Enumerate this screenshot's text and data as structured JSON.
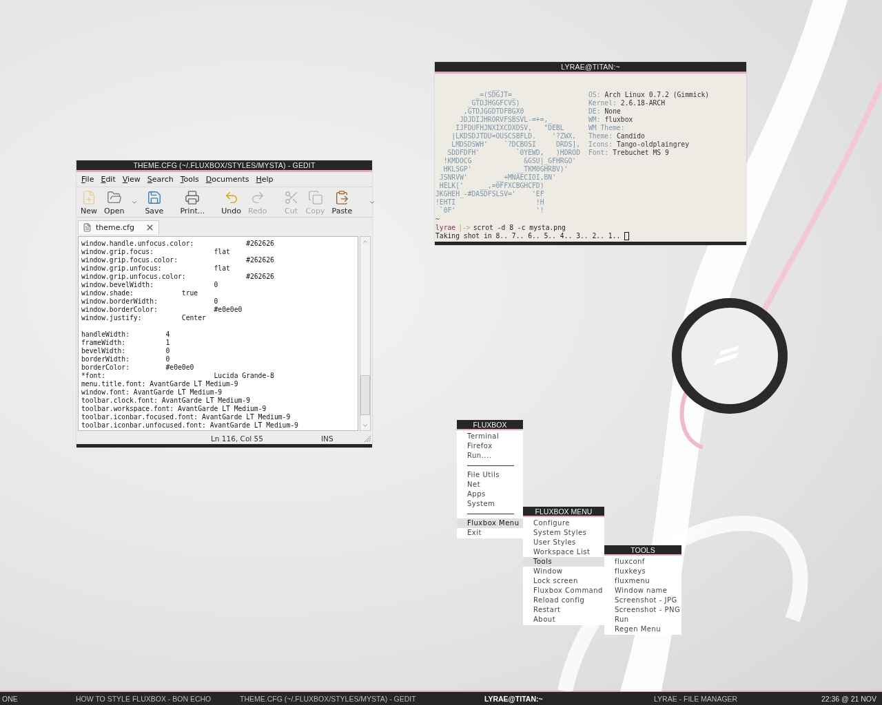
{
  "editor": {
    "title": "THEME.CFG (~/.FLUXBOX/STYLES/MYSTA) - GEDIT",
    "menu": [
      "File",
      "Edit",
      "View",
      "Search",
      "Tools",
      "Documents",
      "Help"
    ],
    "toolbar": [
      {
        "kind": "button",
        "label": "New",
        "disabled": false
      },
      {
        "kind": "button",
        "label": "Open",
        "disabled": false
      },
      {
        "kind": "dropdown"
      },
      {
        "kind": "button",
        "label": "Save",
        "disabled": false
      },
      {
        "kind": "separator"
      },
      {
        "kind": "button",
        "label": "Print...",
        "disabled": false
      },
      {
        "kind": "separator"
      },
      {
        "kind": "button",
        "label": "Undo",
        "disabled": false
      },
      {
        "kind": "button",
        "label": "Redo",
        "disabled": true
      },
      {
        "kind": "separator"
      },
      {
        "kind": "button",
        "label": "Cut",
        "disabled": true
      },
      {
        "kind": "button",
        "label": "Copy",
        "disabled": true
      },
      {
        "kind": "button",
        "label": "Paste",
        "disabled": false
      },
      {
        "kind": "separator"
      },
      {
        "kind": "dropdown"
      }
    ],
    "tab": "theme.cfg",
    "blocks": [
      [
        "window.handle.unfocus.color:             #262626",
        "window.grip.focus:               flat",
        "window.grip.focus.color:                 #262626",
        "window.grip.unfocus:             flat",
        "window.grip.unfocus.color:               #262626",
        "window.bevelWidth:               0",
        "window.shade:            true",
        "window.borderWidth:              0",
        "window.borderColor:              #e0e0e0",
        "window.justify:          Center"
      ],
      [
        "handleWidth:         4",
        "frameWidth:          1",
        "bevelWidth:          0",
        "borderWidth:         0",
        "borderColor:         #e0e0e0",
        "*font:                           Lucida Grande-8",
        "menu.title.font: AvantGarde LT Medium-9",
        "window.font: AvantGarde LT Medium-9",
        "toolbar.clock.font: AvantGarde LT Medium-9",
        "toolbar.workspace.font: AvantGarde LT Medium-9",
        "toolbar.iconbar.focused.font: AvantGarde LT Medium-9",
        "toolbar.iconbar.unfocused.font: AvantGarde LT Medium-9"
      ]
    ],
    "status": {
      "position": "Ln 116, Col 55",
      "mode": "INS"
    }
  },
  "terminal": {
    "title": "LYRAE@TITAN:~",
    "logo": [
      "              __",
      "          _=(SDGJT=_",
      "        _GTDJHGGFCVS)",
      "       ,GTDJGGDTDFBGX0",
      "      JDJDIJHRORVFSBSVL-=+=,_",
      "     IJFDUFHJNXIXCDXDSV,   \"DEBL",
      "    |LKDSDJTDU=OUSCSBFLD.    '?ZWX,",
      "    LMDSDSWH'    `?DCBOSI     DRDS],",
      "   SDDFDFH'         `0YEWD,   )HDROD",
      "  !KMDOCG             &GSU|_GFHRGO'",
      "  HKLSGP'           __TKM0GHRBV)'",
      " JSNRVW'       __+MNAECIOI,BN'",
      " HELK['    __,=0FFXCBGHCFD)",
      "JKGHEH_-#DASDFSLSV='    'EF",
      "!EHTI                    !H",
      " `0F'                    '!"
    ],
    "info": [
      {
        "label": "OS:",
        "value": "Arch Linux 0.7.2 (Gimmick)"
      },
      {
        "label": "Kernel:",
        "value": "2.6.18-ARCH"
      },
      {
        "label": "DE:",
        "value": "None"
      },
      {
        "label": "WM:",
        "value": "fluxbox"
      },
      {
        "label": "WM Theme:"
      },
      {
        "label": "Theme:",
        "value": "Candido"
      },
      {
        "label": "Icons:",
        "value": "Tango-oldplaingrey"
      },
      {
        "label": "Font:",
        "value": "Trebuchet MS 9"
      }
    ],
    "cwd": "~",
    "prompt": {
      "user": "lyrae",
      "arrow": "|->",
      "command": "scrot -d 8 -c mysta.png"
    },
    "output": "Taking shot in 8.. 7.. 6.. 5.. 4.. 3.. 2.. 1.."
  },
  "menus": [
    {
      "title": "FLUXBOX",
      "items": [
        {
          "kind": "item",
          "label": "Terminal",
          "selected": false
        },
        {
          "kind": "item",
          "label": "Firefox",
          "selected": false
        },
        {
          "kind": "item",
          "label": "Run....",
          "selected": false
        },
        {
          "kind": "separator"
        },
        {
          "kind": "item",
          "label": "File Utils",
          "selected": false
        },
        {
          "kind": "item",
          "label": "Net",
          "selected": false
        },
        {
          "kind": "item",
          "label": "Apps",
          "selected": false
        },
        {
          "kind": "item",
          "label": "System",
          "selected": false
        },
        {
          "kind": "separator"
        },
        {
          "kind": "item",
          "label": "Fluxbox Menu",
          "selected": true
        },
        {
          "kind": "item",
          "label": "Exit",
          "selected": false
        }
      ]
    },
    {
      "title": "FLUXBOX MENU",
      "items": [
        {
          "kind": "item",
          "label": "Configure",
          "selected": false
        },
        {
          "kind": "item",
          "label": "System Styles",
          "selected": false
        },
        {
          "kind": "item",
          "label": "User Styles",
          "selected": false
        },
        {
          "kind": "item",
          "label": "Workspace List",
          "selected": false
        },
        {
          "kind": "item",
          "label": "Tools",
          "selected": true
        },
        {
          "kind": "item",
          "label": "Window",
          "selected": false
        },
        {
          "kind": "item",
          "label": "Lock screen",
          "selected": false
        },
        {
          "kind": "item",
          "label": "Fluxbox Command",
          "selected": false
        },
        {
          "kind": "item",
          "label": "Reload config",
          "selected": false
        },
        {
          "kind": "item",
          "label": "Restart",
          "selected": false
        },
        {
          "kind": "item",
          "label": "About",
          "selected": false
        }
      ]
    },
    {
      "title": "TOOLS",
      "items": [
        {
          "kind": "item",
          "label": "fluxconf",
          "selected": false
        },
        {
          "kind": "item",
          "label": "fluxkeys",
          "selected": false
        },
        {
          "kind": "item",
          "label": "fluxmenu",
          "selected": false
        },
        {
          "kind": "item",
          "label": "Window name",
          "selected": false
        },
        {
          "kind": "item",
          "label": "Screenshot - JPG",
          "selected": false
        },
        {
          "kind": "item",
          "label": "Screenshot - PNG",
          "selected": false
        },
        {
          "kind": "item",
          "label": "Run",
          "selected": false
        },
        {
          "kind": "item",
          "label": "Regen Menu",
          "selected": false
        }
      ]
    }
  ],
  "taskbar": {
    "workspace": "ONE",
    "tasks": [
      {
        "label": "HOW TO STYLE FLUXBOX - BON ECHO",
        "selected": false
      },
      {
        "label": "THEME.CFG (~/.FLUXBOX/STYLES/MYSTA) - GEDIT",
        "selected": false
      },
      {
        "label": "LYRAE@TITAN:~",
        "selected": true
      },
      {
        "label": "LYRAE - FILE MANAGER",
        "selected": false
      }
    ],
    "clock": "22:36 @ 21 NOV"
  }
}
